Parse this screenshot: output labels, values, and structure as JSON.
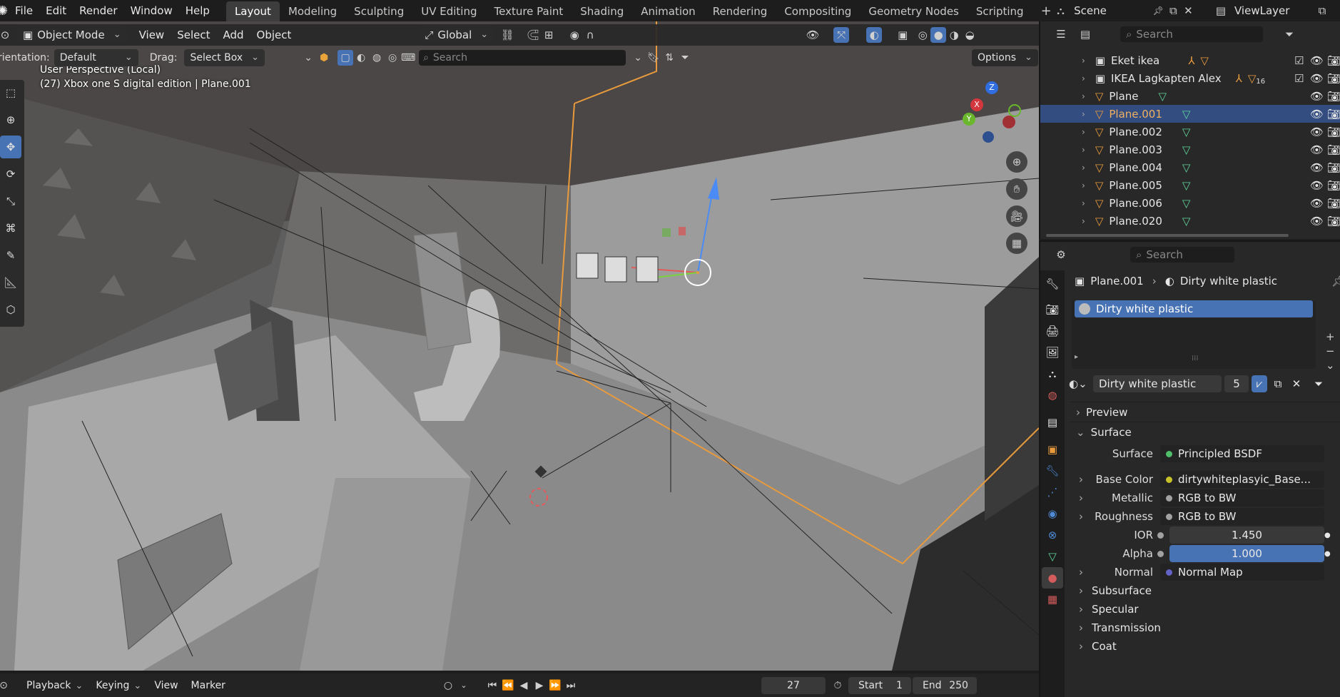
{
  "topbar": {
    "menus": [
      "File",
      "Edit",
      "Render",
      "Window",
      "Help"
    ],
    "workspaces": [
      "Layout",
      "Modeling",
      "Sculpting",
      "UV Editing",
      "Texture Paint",
      "Shading",
      "Animation",
      "Rendering",
      "Compositing",
      "Geometry Nodes",
      "Scripting"
    ],
    "active_workspace": "Layout",
    "scene": "Scene",
    "view_layer": "ViewLayer"
  },
  "viewport_header": {
    "mode": "Object Mode",
    "menus": [
      "View",
      "Select",
      "Add",
      "Object"
    ],
    "transform_orientation": "Global",
    "options": "Options"
  },
  "tool_header": {
    "orientation_label": "Orientation:",
    "orientation_value": "Default",
    "drag_label": "Drag:",
    "drag_value": "Select Box",
    "search_placeholder": "Search"
  },
  "viewport": {
    "info_line1": "User Perspective (Local)",
    "info_line2": "(27) Xbox one S digital edition | Plane.001"
  },
  "outliner": {
    "search_placeholder": "Search",
    "rows": [
      {
        "name": "Eket ikea",
        "selected": false
      },
      {
        "name": "IKEA Lagkapten Alex",
        "selected": false
      },
      {
        "name": "Plane",
        "selected": false
      },
      {
        "name": "Plane.001",
        "selected": true
      },
      {
        "name": "Plane.002",
        "selected": false
      },
      {
        "name": "Plane.003",
        "selected": false
      },
      {
        "name": "Plane.004",
        "selected": false
      },
      {
        "name": "Plane.005",
        "selected": false
      },
      {
        "name": "Plane.006",
        "selected": false
      },
      {
        "name": "Plane.020",
        "selected": false
      }
    ],
    "alex_badge": "16"
  },
  "properties": {
    "search_placeholder": "Search",
    "breadcrumb_object": "Plane.001",
    "breadcrumb_material": "Dirty white plastic",
    "slot_name": "Dirty white plastic",
    "material_name": "Dirty white plastic",
    "user_count": "5",
    "sections": {
      "preview": "Preview",
      "surface": "Surface",
      "subsurface": "Subsurface",
      "specular": "Specular",
      "transmission": "Transmission",
      "coat": "Coat"
    },
    "fields": [
      {
        "label": "Surface",
        "value": "Principled BSDF",
        "dot": "#4fbf6a",
        "expand": false
      },
      {
        "label": "Base Color",
        "value": "dirtywhiteplasyic_Base...",
        "dot": "#c7c229",
        "expand": true
      },
      {
        "label": "Metallic",
        "value": "RGB to BW",
        "dot": "#a1a1a1",
        "expand": true
      },
      {
        "label": "Roughness",
        "value": "RGB to BW",
        "dot": "#a1a1a1",
        "expand": true
      },
      {
        "label": "IOR",
        "value": "1.450",
        "dot": "#a1a1a1",
        "expand": false
      },
      {
        "label": "Alpha",
        "value": "1.000",
        "dot": "#a1a1a1",
        "expand": false
      },
      {
        "label": "Normal",
        "value": "Normal Map",
        "dot": "#6363c7",
        "expand": true
      }
    ]
  },
  "timeline": {
    "menus": [
      "Playback",
      "Keying",
      "View",
      "Marker"
    ],
    "current_frame": "27",
    "start_label": "Start",
    "start_value": "1",
    "end_label": "End",
    "end_value": "250"
  },
  "colors": {
    "accent": "#4772b3",
    "selected_row": "#334d80",
    "object_orange": "#e89a3c",
    "mesh_green": "#5fd39a"
  }
}
